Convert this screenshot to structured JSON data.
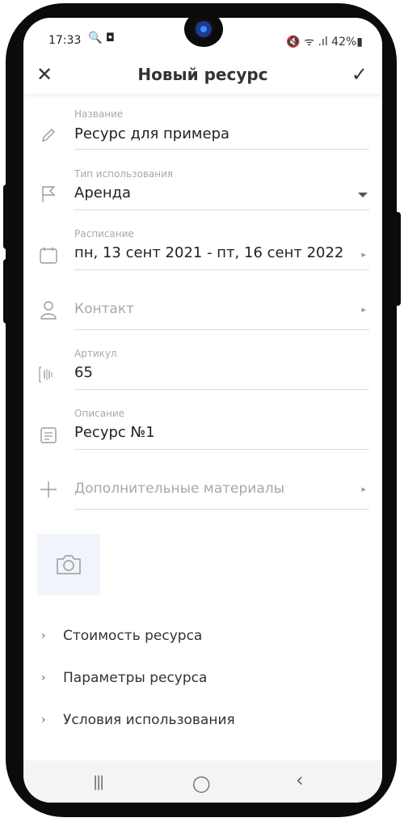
{
  "status_bar": {
    "time": "17:33",
    "left_icons": "🔍 ◘",
    "right": "🔇 ᯤ .ıl 42%▮"
  },
  "app_bar": {
    "title": "Новый ресурс",
    "close_icon": "✕",
    "confirm_icon": "✓"
  },
  "fields": {
    "name": {
      "label": "Название",
      "value": "Ресурс для примера"
    },
    "usage_type": {
      "label": "Тип использования",
      "value": "Аренда"
    },
    "schedule": {
      "label": "Расписание",
      "value": "пн, 13 сент 2021 - пт, 16 сент 2022"
    },
    "contact": {
      "placeholder": "Контакт"
    },
    "article": {
      "label": "Артикул",
      "value": "65"
    },
    "description": {
      "label": "Описание",
      "value": "Ресурс №1"
    },
    "materials": {
      "placeholder": "Дополнительные материалы"
    }
  },
  "sections": [
    {
      "title": "Стоимость ресурса"
    },
    {
      "title": "Параметры ресурса"
    },
    {
      "title": "Условия использования"
    }
  ],
  "nav": {
    "recents": "|||",
    "home": "◯",
    "back": "‹"
  }
}
